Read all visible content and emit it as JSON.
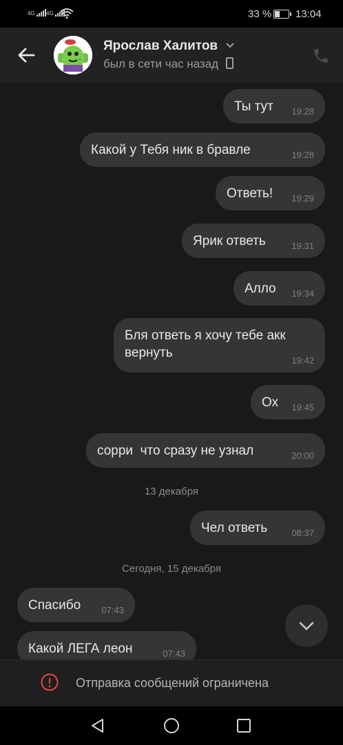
{
  "status_bar": {
    "battery": "33 %",
    "time": "13:04"
  },
  "header": {
    "name": "Ярослав Халитов",
    "status": "был в сети час назад"
  },
  "messages": [
    {
      "text": "Ты тут",
      "time": "19:28"
    },
    {
      "text": "Какой у Тебя ник в бравле",
      "time": "19:28"
    },
    {
      "text": "Ответь!",
      "time": "19:29"
    },
    {
      "text": "Ярик ответь",
      "time": "19:31"
    },
    {
      "text": "Алло",
      "time": "19:34"
    },
    {
      "line1": "Бля ответь я хочу тебе акк",
      "line2": "вернуть",
      "time": "19:42"
    },
    {
      "text": "Ох",
      "time": "19:45"
    },
    {
      "text": "сорри  что сразу не узнал",
      "time": "20:00"
    },
    {
      "text": "Чел ответь",
      "time": "08:37"
    },
    {
      "text": "Спасибо",
      "time": "07:43"
    },
    {
      "text": "Какой ЛЕГА леон",
      "time": "07:43"
    }
  ],
  "dates": {
    "first": "13 декабря",
    "second": "Сегодня, 15 декабря"
  },
  "bottom": {
    "blocked_text": "Отправка сообщений ограничена"
  },
  "icons": [
    "signal-icon",
    "wifi-icon",
    "battery-icon",
    "back-arrow-icon",
    "chevron-down-icon",
    "mobile-phone-icon",
    "call-icon",
    "chevron-down-icon",
    "warning-icon",
    "nav-back-icon",
    "nav-home-icon",
    "nav-recents-icon"
  ],
  "colors": {
    "background": "#19191a",
    "bubble": "#353536",
    "header": "#222223",
    "warning": "#e64646"
  }
}
